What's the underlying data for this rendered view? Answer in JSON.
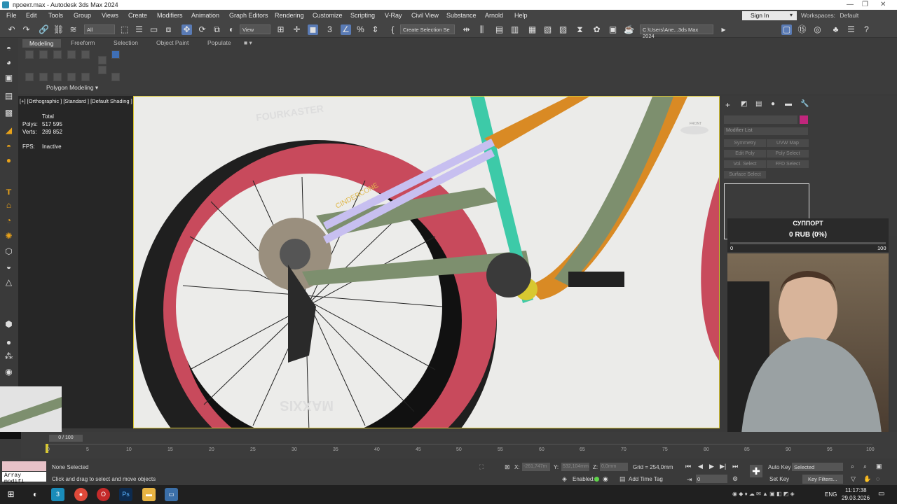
{
  "window": {
    "title": "проект.max - Autodesk 3ds Max 2024",
    "min": "—",
    "max": "❐",
    "close": "✕"
  },
  "menu": [
    "File",
    "Edit",
    "Tools",
    "Group",
    "Views",
    "Create",
    "Modifiers",
    "Animation",
    "Graph Editors",
    "Rendering",
    "Customize",
    "Scripting",
    "V-Ray",
    "Civil View",
    "Substance",
    "Arnold",
    "Help"
  ],
  "account": {
    "sign_in": "Sign In",
    "workspace_label": "Workspaces:",
    "workspace_value": "Default"
  },
  "toolbar": {
    "filter": "All",
    "ref_coord": "View",
    "selection_set": "Create Selection Se",
    "path": "C:\\Users\\Ane...3ds Max 2024"
  },
  "ribbon": {
    "tabs": [
      "Modeling",
      "Freeform",
      "Selection",
      "Object Paint",
      "Populate"
    ],
    "panel": "Polygon Modeling ▾"
  },
  "viewport": {
    "label": "[+] [Orthographic ] [Standard ] [Default Shading ]",
    "stats": {
      "total": "Total",
      "polys_label": "Polys:",
      "polys": "517 595",
      "verts_label": "Verts:",
      "verts": "289 852",
      "fps_label": "FPS:",
      "fps": "Inactive"
    },
    "tire_top_text": "FOURKASTER",
    "tire_bottom_text": "MAXXIS",
    "frame_text": "CINDERCONE",
    "gizmo": "FRONT"
  },
  "command_panel": {
    "modifier_list": "Modifier List",
    "buttons": [
      "Symmetry",
      "UVW Map",
      "Edit Poly",
      "Poly Select",
      "Vol. Select",
      "FFD Select",
      "Surface Select"
    ],
    "color_swatch": "#c0267c"
  },
  "support": {
    "title": "СУППОРТ",
    "amount": "0 RUB (0%)",
    "min": "0",
    "max": "100"
  },
  "timeline": {
    "frame": "0 / 100",
    "ticks": [
      "0",
      "5",
      "10",
      "15",
      "20",
      "25",
      "30",
      "35",
      "40",
      "45",
      "50",
      "55",
      "60",
      "65",
      "70",
      "75",
      "80",
      "85",
      "90",
      "95",
      "100"
    ]
  },
  "status": {
    "modifier_box": "Array modifi",
    "selection": "None Selected",
    "prompt": "Click and drag to select and move objects",
    "x_label": "X:",
    "x": "-261,747m",
    "y_label": "Y:",
    "y": "532,104mm",
    "z_label": "Z:",
    "z": "0,0mm",
    "grid": "Grid = 254,0mm",
    "enabled": "Enabled:",
    "add_time_tag": "Add Time Tag",
    "auto_key": "Auto Key",
    "set_key": "Set Key",
    "key_mode": "Selected",
    "key_filters": "Key Filters...",
    "frame_field": "0"
  },
  "taskbar": {
    "lang": "ENG",
    "time": "11:17:38",
    "date": "29.03.2026"
  }
}
